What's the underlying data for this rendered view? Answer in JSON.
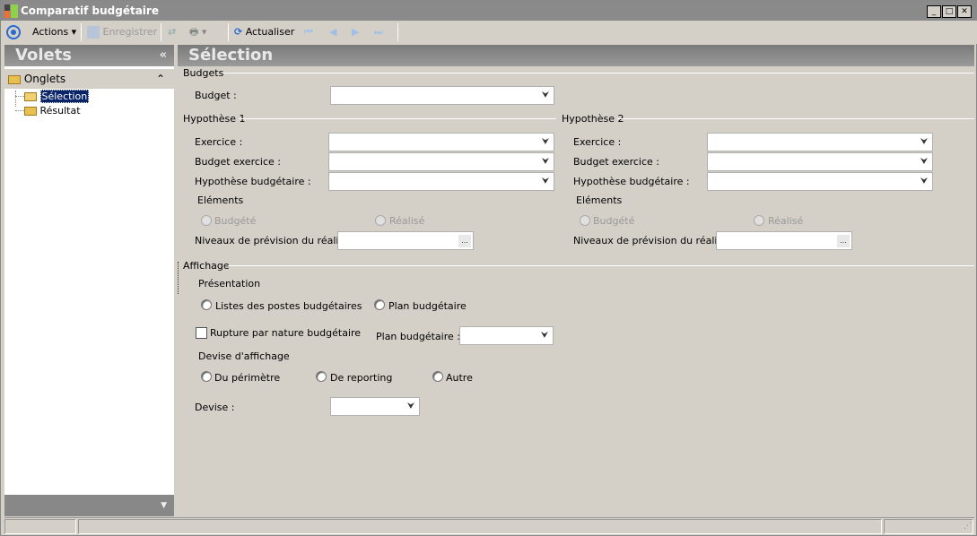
{
  "window": {
    "title": "Comparatif budgétaire"
  },
  "toolbar": {
    "actions": "Actions",
    "save": "Enregistrer",
    "refresh": "Actualiser"
  },
  "left_pane": {
    "title": "Volets",
    "collapse": "«",
    "section": "Onglets",
    "tree": [
      {
        "label": "Sélection",
        "selected": true
      },
      {
        "label": "Résultat",
        "selected": false
      }
    ]
  },
  "main": {
    "title": "Sélection",
    "budgets": {
      "group": "Budgets",
      "budget_label": "Budget :",
      "budget_value": ""
    },
    "hyp1": {
      "group": "Hypothèse 1",
      "exercice": "Exercice :",
      "budget_exercice": "Budget exercice :",
      "hypothese": "Hypothèse budgétaire :",
      "elements": "Eléments",
      "budgete": "Budgété",
      "realise": "Réalisé",
      "niveaux": "Niveaux de prévision du réalisé :"
    },
    "hyp2": {
      "group": "Hypothèse 2",
      "exercice": "Exercice :",
      "budget_exercice": "Budget exercice :",
      "hypothese": "Hypothèse budgétaire :",
      "elements": "Eléments",
      "budgete": "Budgété",
      "realise": "Réalisé",
      "niveaux": "Niveaux de prévision du réalisé :"
    },
    "affichage": {
      "group": "Affichage",
      "presentation": "Présentation",
      "listes": "Listes des postes budgétaires",
      "plan": "Plan budgétaire",
      "rupture": "Rupture par nature budgétaire",
      "rupture_checked": false,
      "plan_label": "Plan budgétaire :",
      "devise_affichage": "Devise d'affichage",
      "perimetre": "Du périmètre",
      "reporting": "De reporting",
      "autre": "Autre",
      "devise_label": "Devise :"
    }
  },
  "ellipsis": "...",
  "colors": {
    "titlebar": "#8a8a8a",
    "panel_header": "#8a8a8a",
    "background": "#d4d0c8",
    "selection": "#0a246a"
  }
}
